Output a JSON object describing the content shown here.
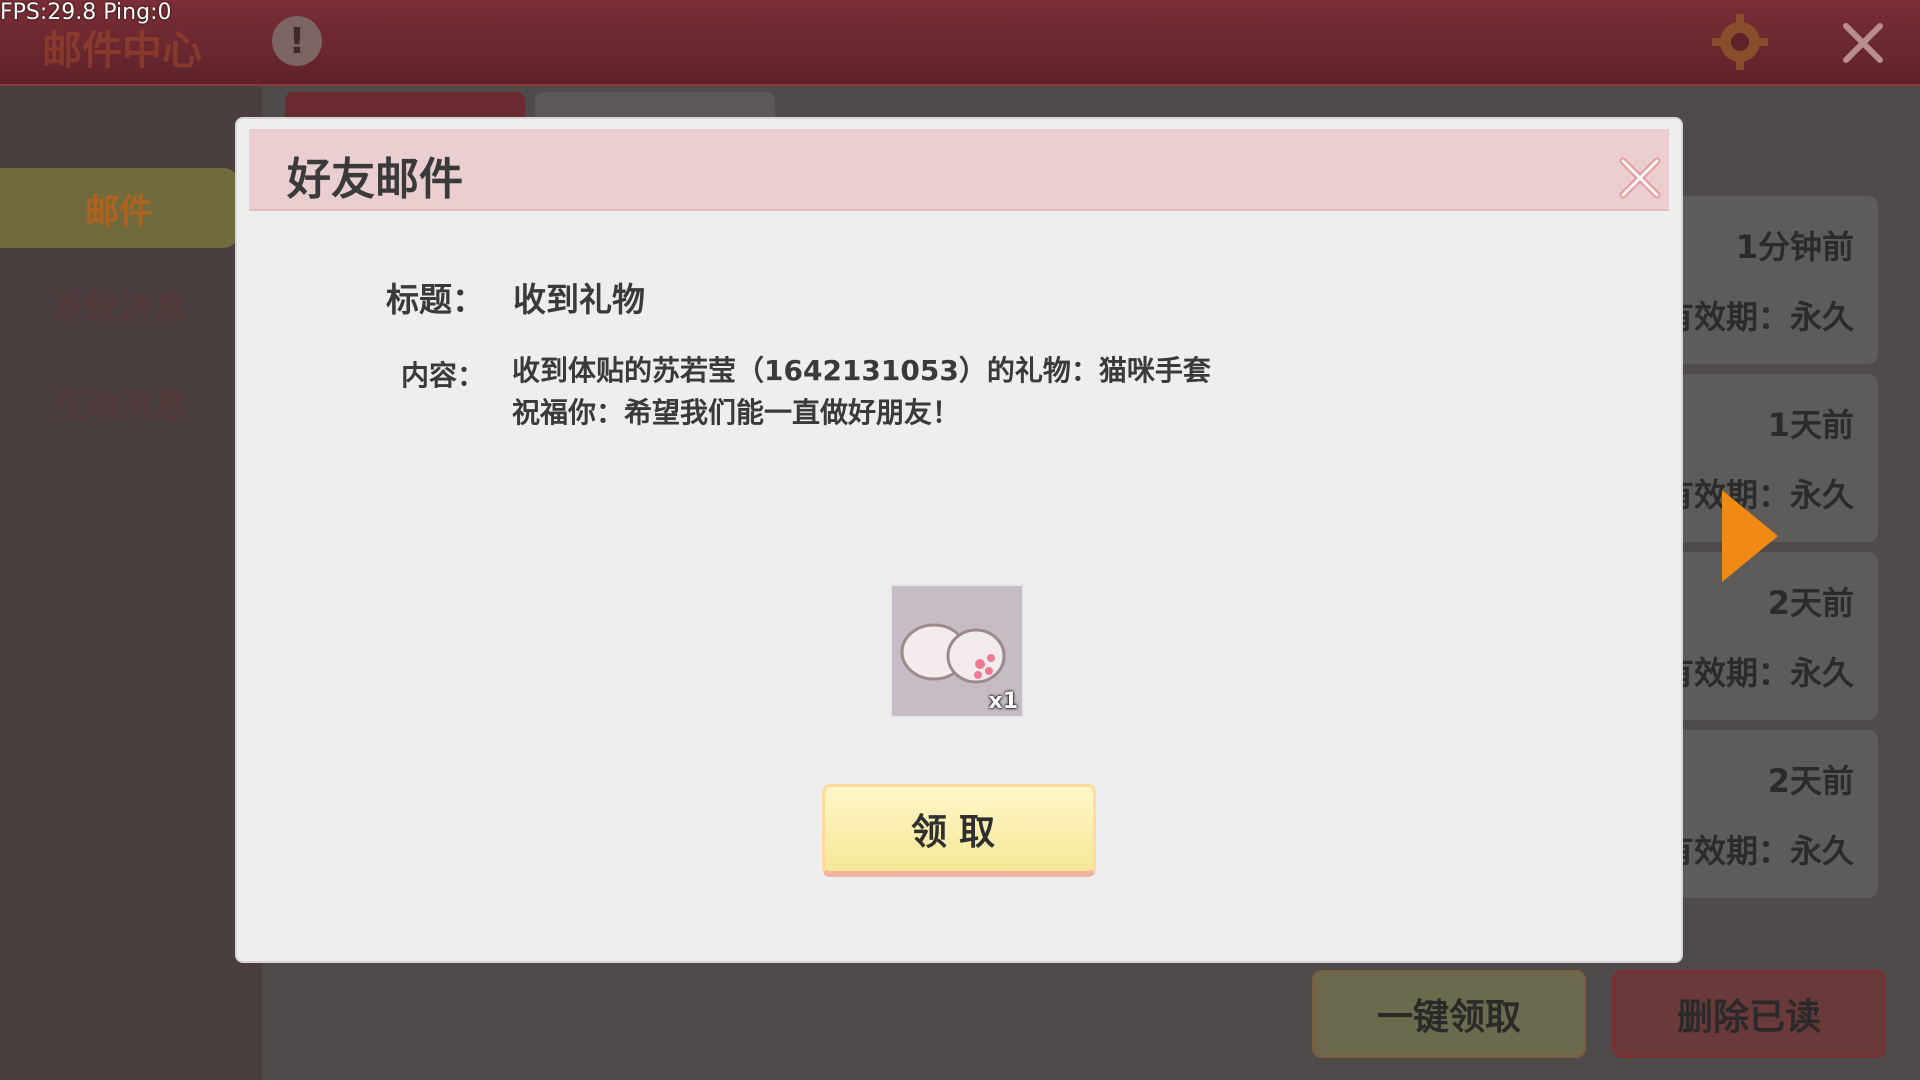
{
  "hud": {
    "fps": "FPS:29.8  Ping:0"
  },
  "background": {
    "center_title": "邮件中心",
    "info_icon": "!",
    "tabs": [
      "",
      ""
    ],
    "sidebar": [
      "邮件",
      "系统消息",
      "互动消息"
    ],
    "mails": [
      {
        "time": "1分钟前",
        "expiry": "有效期：永久"
      },
      {
        "time": "1天前",
        "expiry": "有效期：永久"
      },
      {
        "time": "2天前",
        "expiry": "有效期：永久"
      },
      {
        "time": "2天前",
        "expiry": "有效期：永久"
      }
    ],
    "claim_all_label": "一键领取",
    "delete_read_label": "删除已读"
  },
  "dialog": {
    "title": "好友邮件",
    "subject_label": "标题：",
    "subject": "收到礼物",
    "content_label": "内容：",
    "content_line1": "收到体贴的苏若莹（1642131053）的礼物：猫咪手套",
    "content_line2": "祝福你：希望我们能一直做好朋友！",
    "item": {
      "icon": "cat-glove-icon",
      "quantity": "x1"
    },
    "claim_label": "领取"
  },
  "colors": {
    "accent_orange": "#f08a14",
    "header_pink": "#ebcfd0",
    "button_yellow": "#f6e796"
  }
}
